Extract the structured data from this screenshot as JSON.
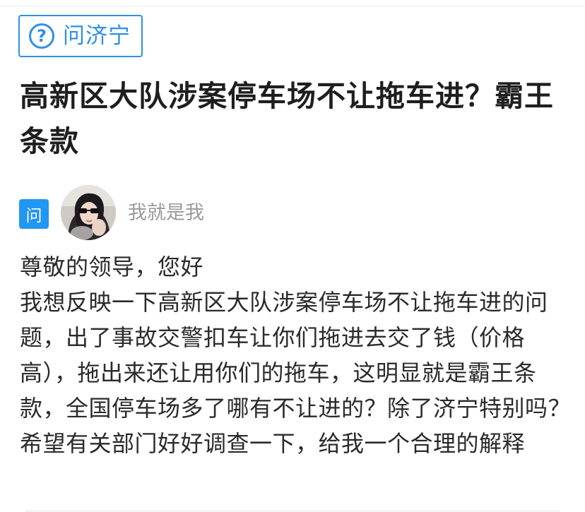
{
  "tag": {
    "icon": "question-circle-icon",
    "icon_glyph": "?",
    "label": "问济宁"
  },
  "question": {
    "title": "高新区大队涉案停车场不让拖车进？霸王条款"
  },
  "asker": {
    "badge": "问",
    "username": "我就是我"
  },
  "content": {
    "greeting": "尊敬的领导，您好",
    "body": "我想反映一下高新区大队涉案停车场不让拖车进的问题，出了事故交警扣车让你们拖进去交了钱（价格高），拖出来还让用你们的拖车，这明显就是霸王条款，全国停车场多了哪有不让进的？除了济宁特别吗？希望有关部门好好调查一下，给我一个合理的解释"
  },
  "colors": {
    "accent": "#2f8fe6",
    "badge": "#2196f3",
    "title": "#1e1e1e",
    "muted": "#9a9a9a"
  }
}
